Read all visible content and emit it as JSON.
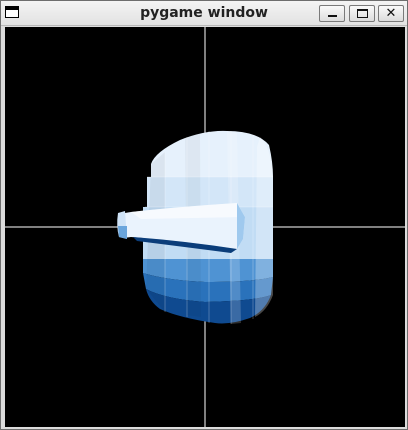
{
  "window": {
    "title": "pygame window",
    "close_glyph": "✕",
    "icons": {
      "app": "window-icon",
      "minimize": "minimize-icon",
      "maximize": "maximize-icon",
      "close": "close-icon"
    }
  },
  "scene": {
    "background": "#000000",
    "crosshair_color": "#ffffff",
    "object": "shaded-blue-3d-mesh",
    "palette": [
      "#0d3f7f",
      "#2a72bb",
      "#4f93d3",
      "#9fc9ee",
      "#d7eafb",
      "#f2f8ff"
    ]
  }
}
